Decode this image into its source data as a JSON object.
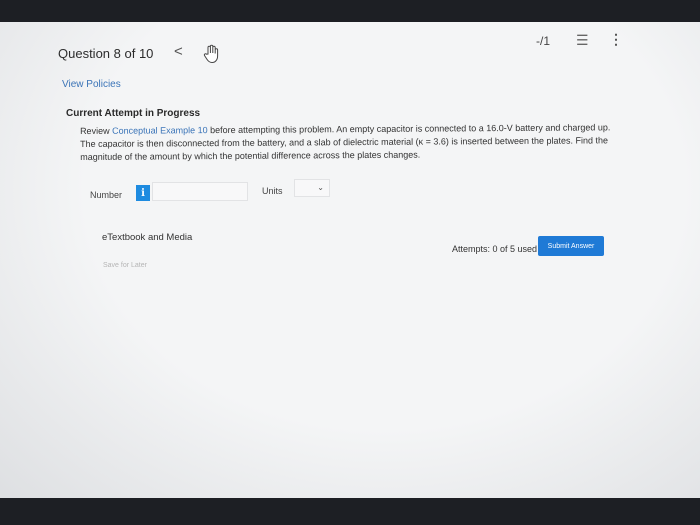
{
  "header": {
    "question_label": "Question 8 of 10",
    "prev_glyph": "<",
    "score": "-/1",
    "list_glyph": "☰",
    "menu_glyph": "⋮"
  },
  "links": {
    "view_policies": "View Policies"
  },
  "attempt": {
    "heading": "Current Attempt in Progress"
  },
  "problem": {
    "prefix": "Review ",
    "link_text": "Conceptual Example 10",
    "body": " before attempting this problem. An empty capacitor is connected to a 16.0-V battery and charged up. The capacitor is then disconnected from the battery, and a slab of dielectric material (κ = 3.6) is inserted between the plates. Find the magnitude of the amount by which the potential difference across the plates changes."
  },
  "answer": {
    "number_label": "Number",
    "info_glyph": "i",
    "number_value": "",
    "units_label": "Units",
    "units_value": "",
    "units_chevron": "⌄"
  },
  "resources": {
    "etextbook": "eTextbook and Media",
    "save_later": "Save for Later"
  },
  "submission": {
    "attempts": "Attempts: 0 of 5 used",
    "submit_label": "Submit Answer"
  },
  "colors": {
    "link": "#3a74b8",
    "primary_button": "#1f7ad6",
    "info_badge": "#1e8be0"
  },
  "icons": [
    "chevron-left-icon",
    "hand-cursor-icon",
    "list-icon",
    "kebab-menu-icon",
    "info-icon",
    "chevron-down-icon"
  ]
}
